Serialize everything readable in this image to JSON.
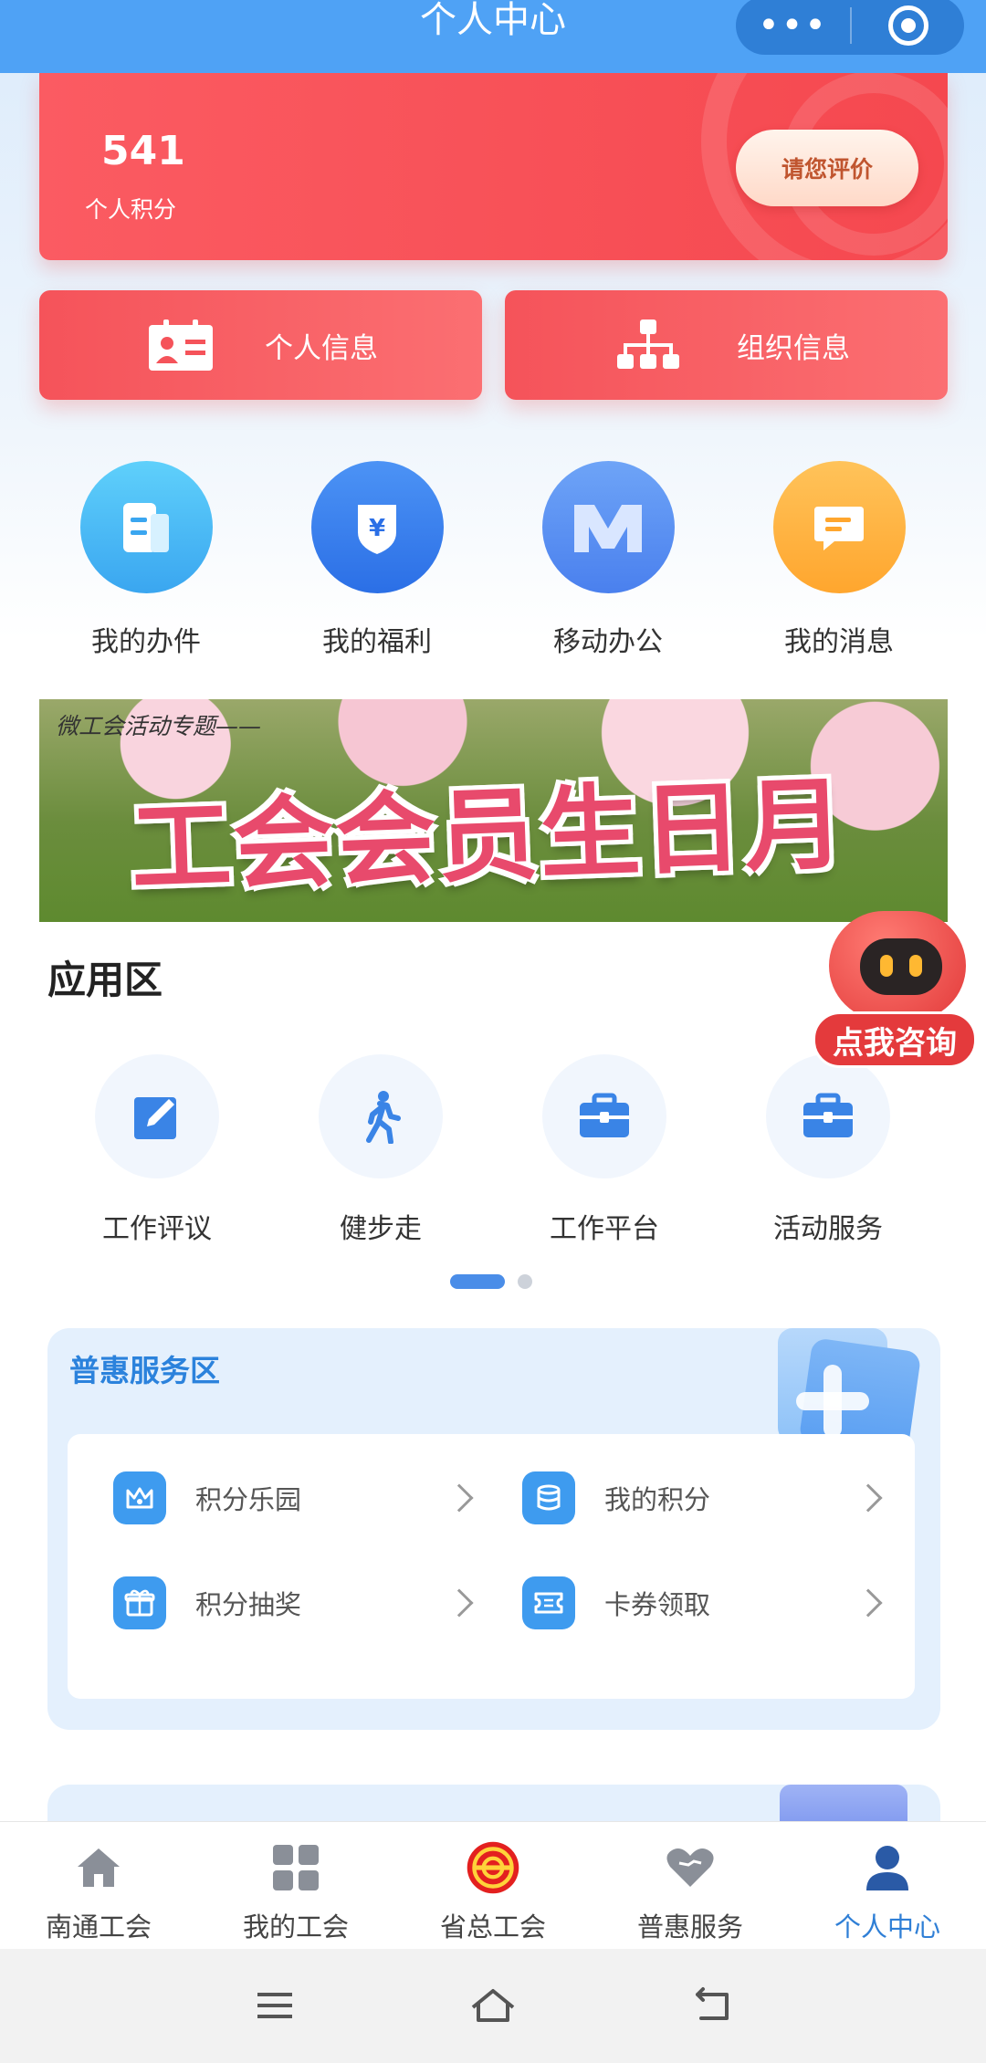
{
  "header": {
    "title": "个人中心",
    "more_glyph": "•••"
  },
  "points": {
    "value": "541",
    "label": "个人积分",
    "rate_button": "请您评价"
  },
  "info_buttons": {
    "personal": "个人信息",
    "organization": "组织信息"
  },
  "quick_items": [
    {
      "label": "我的办件",
      "icon": "document-icon",
      "color": "#4cb7f5"
    },
    {
      "label": "我的福利",
      "icon": "yen-shield-icon",
      "color": "#3f84f0"
    },
    {
      "label": "移动办公",
      "icon": "m-logo-icon",
      "color": "#5a8ff0"
    },
    {
      "label": "我的消息",
      "icon": "message-icon",
      "color": "#ffb43d"
    }
  ],
  "banner": {
    "subtitle": "微工会活动专题——",
    "title": "工会会员生日月"
  },
  "apps": {
    "title": "应用区",
    "items": [
      {
        "label": "工作评议",
        "icon": "edit-icon"
      },
      {
        "label": "健步走",
        "icon": "walking-icon"
      },
      {
        "label": "工作平台",
        "icon": "briefcase-icon"
      },
      {
        "label": "活动服务",
        "icon": "briefcase-icon"
      }
    ]
  },
  "robot": {
    "label": "点我咨询"
  },
  "benefit": {
    "title": "普惠服务区",
    "items": [
      {
        "label": "积分乐园",
        "icon": "crown-icon"
      },
      {
        "label": "我的积分",
        "icon": "database-icon"
      },
      {
        "label": "积分抽奖",
        "icon": "gift-icon"
      },
      {
        "label": "卡券领取",
        "icon": "ticket-icon"
      }
    ]
  },
  "tabbar": [
    {
      "label": "南通工会",
      "icon": "home-icon"
    },
    {
      "label": "我的工会",
      "icon": "grid-icon"
    },
    {
      "label": "省总工会",
      "icon": "union-emblem-icon"
    },
    {
      "label": "普惠服务",
      "icon": "heart-icon"
    },
    {
      "label": "个人中心",
      "icon": "user-icon",
      "active": true
    }
  ],
  "colors": {
    "primary": "#4fa2f5",
    "accent_red": "#f5484f",
    "active_tab": "#2f7fd6"
  }
}
